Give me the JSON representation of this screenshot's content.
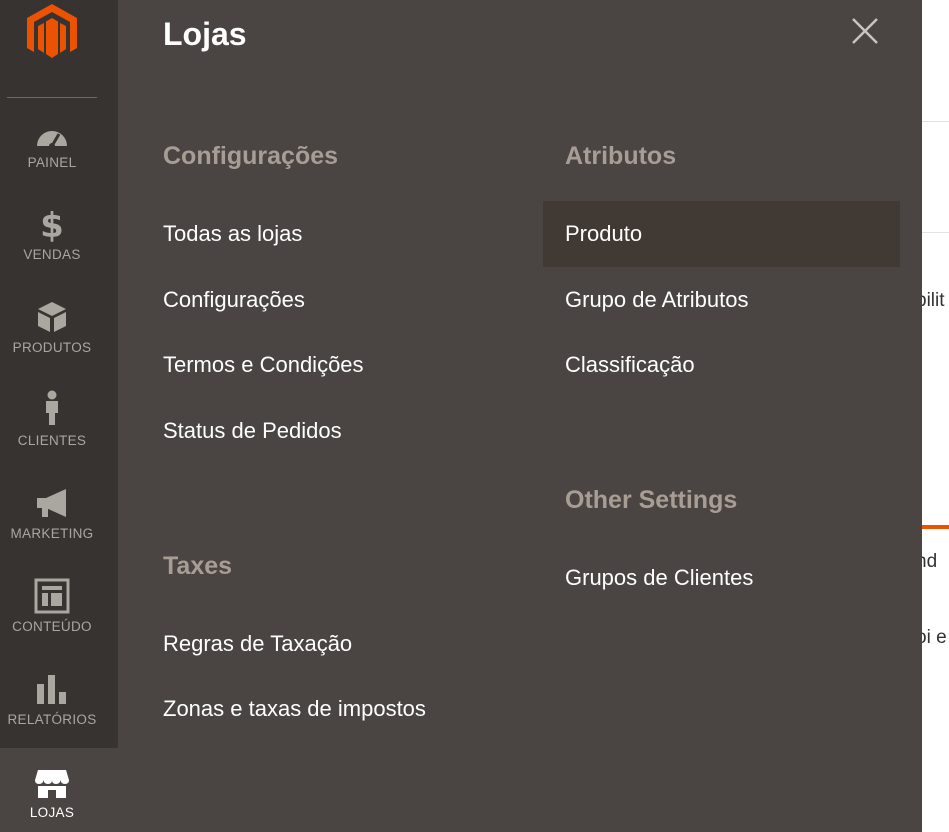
{
  "sidebar": {
    "logo_icon": "magento-logo-icon",
    "accent_color": "#eb5202",
    "items": [
      {
        "label": "PAINEL",
        "icon": "dashboard-gauge-icon"
      },
      {
        "label": "VENDAS",
        "icon": "dollar-icon"
      },
      {
        "label": "PRODUTOS",
        "icon": "box-icon"
      },
      {
        "label": "CLIENTES",
        "icon": "person-icon"
      },
      {
        "label": "MARKETING",
        "icon": "megaphone-icon"
      },
      {
        "label": "CONTEÚDO",
        "icon": "layout-icon"
      },
      {
        "label": "RELATÓRIOS",
        "icon": "bar-chart-icon"
      },
      {
        "label": "LOJAS",
        "icon": "store-icon",
        "active": true
      }
    ]
  },
  "submenu": {
    "title": "Lojas",
    "close_icon": "close-icon",
    "groups": [
      {
        "title": "Configurações",
        "links": [
          "Todas as lojas",
          "Configurações",
          "Termos e Condições",
          "Status de Pedidos"
        ]
      },
      {
        "title": "Taxes",
        "links": [
          "Regras de Taxação",
          "Zonas e taxas de impostos"
        ]
      },
      {
        "title": "Atributos",
        "links": [
          "Produto",
          "Grupo de Atributos",
          "Classificação"
        ]
      },
      {
        "title": "Other Settings",
        "links": [
          "Grupos de Clientes"
        ]
      }
    ],
    "highlighted_link": "Produto"
  },
  "background_page": {
    "fragments": [
      "bilit",
      "nd",
      "oi e"
    ]
  }
}
